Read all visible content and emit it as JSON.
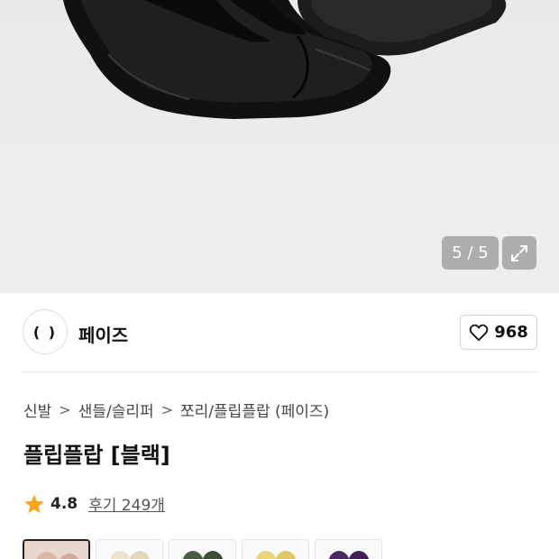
{
  "gallery": {
    "counter": "5 / 5",
    "counter_bg": "#8a8a8a"
  },
  "brand": {
    "logo_text": "( )",
    "name": "페이즈"
  },
  "like": {
    "count": "968"
  },
  "breadcrumb": {
    "items": [
      "신발",
      "샌들/슬리퍼",
      "쪼리/플립플랍 (페이즈)"
    ],
    "separator": ">"
  },
  "product": {
    "title": "플립플랍 [블랙]"
  },
  "rating": {
    "score": "4.8",
    "review_label": "후기 249개",
    "star_color": "#f5a623"
  },
  "color_options": [
    {
      "name": "swatch-1",
      "color": "#d9b7a8"
    },
    {
      "name": "swatch-2",
      "color": "#ece3cf"
    },
    {
      "name": "swatch-3",
      "color": "#4a5a45"
    },
    {
      "name": "swatch-4",
      "color": "#e8d57a"
    },
    {
      "name": "swatch-5",
      "color": "#4b2a63"
    }
  ]
}
